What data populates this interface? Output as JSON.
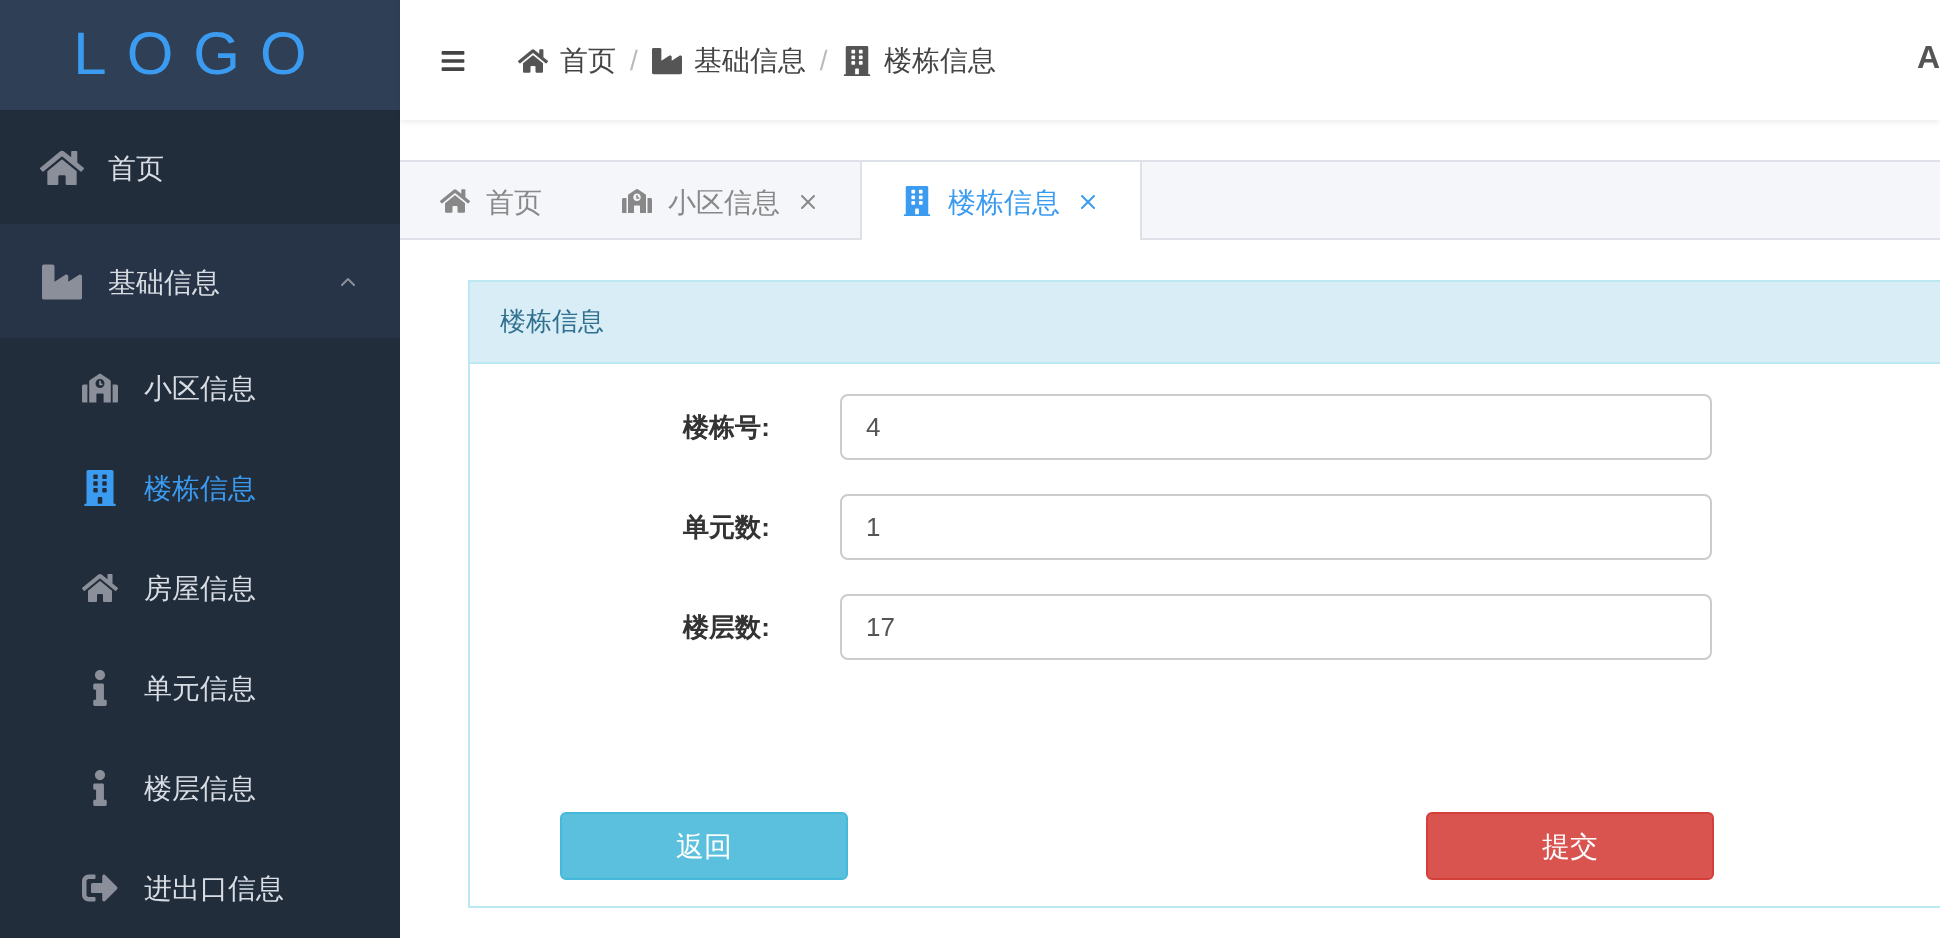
{
  "logo": "LOGO",
  "sidebar": {
    "items": [
      {
        "label": "首页",
        "selected": false
      },
      {
        "label": "基础信息",
        "selected": false,
        "expanded": true,
        "children": [
          {
            "label": "小区信息",
            "selected": false
          },
          {
            "label": "楼栋信息",
            "selected": true
          },
          {
            "label": "房屋信息",
            "selected": false
          },
          {
            "label": "单元信息",
            "selected": false
          },
          {
            "label": "楼层信息",
            "selected": false
          },
          {
            "label": "进出口信息",
            "selected": false
          }
        ]
      }
    ]
  },
  "header": {
    "breadcrumb": [
      {
        "label": "首页"
      },
      {
        "separator": "/",
        "label": "基础信息"
      },
      {
        "separator": "/",
        "label": "楼栋信息"
      }
    ],
    "user": "A"
  },
  "tabs": [
    {
      "label": "首页",
      "selected": false,
      "closable": false
    },
    {
      "label": "小区信息",
      "selected": false,
      "closable": true
    },
    {
      "label": "楼栋信息",
      "selected": true,
      "closable": true
    }
  ],
  "panel": {
    "title": "楼栋信息",
    "fields": [
      {
        "label": "楼栋号:",
        "value": "4"
      },
      {
        "label": "单元数:",
        "value": "1"
      },
      {
        "label": "楼层数:",
        "value": "17"
      }
    ],
    "buttons": [
      {
        "label": "返回",
        "kind": "back"
      },
      {
        "label": "提交",
        "kind": "submit"
      }
    ]
  }
}
